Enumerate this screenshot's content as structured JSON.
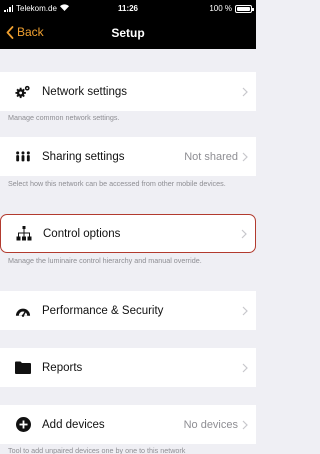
{
  "status_bar": {
    "carrier": "Telekom.de",
    "time": "11:26",
    "battery_label": "100 %",
    "battery_level": 1.0
  },
  "nav": {
    "back_label": "Back",
    "title": "Setup"
  },
  "rows": {
    "network": {
      "label": "Network settings",
      "icon": "gears-icon",
      "description": "Manage common network settings."
    },
    "sharing": {
      "label": "Sharing settings",
      "value": "Not shared",
      "icon": "people-icon",
      "description": "Select how this network can be accessed from other mobile devices."
    },
    "control": {
      "label": "Control options",
      "icon": "hierarchy-icon",
      "description": "Manage the luminaire control hierarchy and manual override."
    },
    "performance": {
      "label": "Performance & Security",
      "icon": "speedometer-icon"
    },
    "reports": {
      "label": "Reports",
      "icon": "folder-icon"
    },
    "add_devices": {
      "label": "Add devices",
      "value": "No devices",
      "icon": "plus-circle-icon",
      "description": "Tool to add unpaired devices one by one to this network"
    }
  },
  "colors": {
    "accent": "#f0a030",
    "highlight_border": "#b23a2e",
    "background": "#efeff4"
  }
}
